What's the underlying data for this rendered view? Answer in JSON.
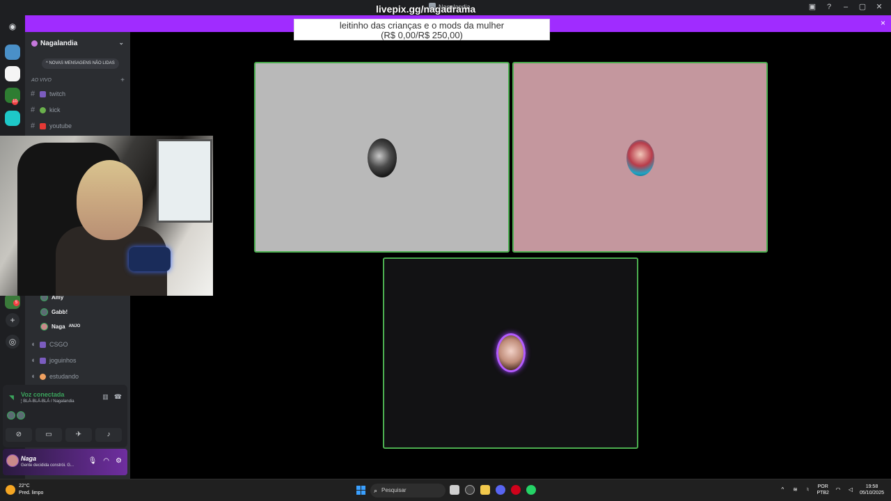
{
  "window": {
    "title": "Nagalandia",
    "controls": [
      "minimize-icon",
      "maximize-icon",
      "close-icon"
    ]
  },
  "overlay": {
    "url": "livepix.gg/nagadrama",
    "donation_line1": "leitinho das crianças e o mods da mulher",
    "donation_line2": "(R$ 0,00/R$ 250,00)",
    "banner_close": "×",
    "banner_color": "#a02cff"
  },
  "server_rail": {
    "badges": [
      "10",
      "5"
    ]
  },
  "sidebar": {
    "server_name": "Nagalandia",
    "new_messages_pill": "NOVAS MENSAGENS NÃO LIDAS",
    "category": "AO VIVO",
    "channels": [
      {
        "label": "twitch",
        "icon": "controller-icon"
      },
      {
        "label": "kick",
        "icon": "alien-icon"
      },
      {
        "label": "youtube",
        "icon": "youtube-icon"
      }
    ],
    "voice_members": [
      {
        "name": "Amy",
        "tag": ""
      },
      {
        "name": "Gabb!",
        "tag": ""
      },
      {
        "name": "Naga",
        "tag": "ANJO"
      }
    ],
    "voice_channels": [
      {
        "label": "CSGO"
      },
      {
        "label": "joguinhos"
      },
      {
        "label": "estudando"
      }
    ]
  },
  "voice_panel": {
    "status": "Voz conectada",
    "channel": "¦ BLÁ-BLÁ-BLÁ / Nagalandia",
    "buttons": [
      "camera-off-icon",
      "screen-share-icon",
      "activity-icon",
      "soundboard-icon"
    ]
  },
  "user": {
    "name": "Naga",
    "status": "Gente decidida constrói. G..."
  },
  "stage": {
    "border_color": "#4caf50",
    "tiles": [
      {
        "bg": "#b9b9b9"
      },
      {
        "bg": "#c4979e"
      },
      {
        "bg": "#121214",
        "speaking": true
      }
    ]
  },
  "taskbar": {
    "temperature": "22°C",
    "weather": "Pred. limpo",
    "search_placeholder": "Pesquisar",
    "lang_top": "POR",
    "lang_bottom": "PTB2",
    "time": "19:58",
    "date": "05/10/2025"
  }
}
